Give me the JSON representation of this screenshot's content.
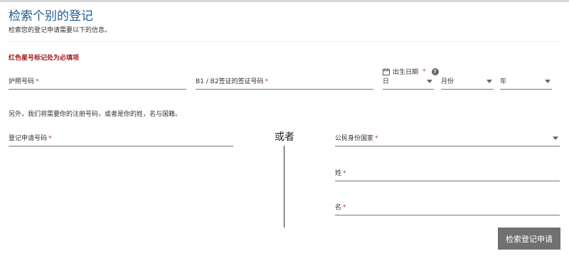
{
  "header": {
    "title": "检索个别的登记",
    "subtitle": "检索您的登记申请需要以下的信息。"
  },
  "required_note": "红色星号标记处为必填项",
  "fields": {
    "passport": {
      "label": "护照号码",
      "star": "*"
    },
    "visa": {
      "label": "B1 / B2签证的签证号码",
      "star": "*"
    },
    "dob": {
      "label": "出生日期",
      "star": "*",
      "help": "?",
      "day": "日",
      "month": "月份",
      "year": "年"
    },
    "registration": {
      "label": "登记申请号码",
      "star": "*"
    },
    "citizenship": {
      "label": "公民身份国家",
      "star": "*"
    },
    "surname": {
      "label": "姓",
      "star": "*"
    },
    "given_name": {
      "label": "名",
      "star": "*"
    }
  },
  "also_note": "另外，我们将需要你的注册号码，或者是你的姓，名与国籍。",
  "or_label": "或者",
  "search_button": "检索登记申请"
}
